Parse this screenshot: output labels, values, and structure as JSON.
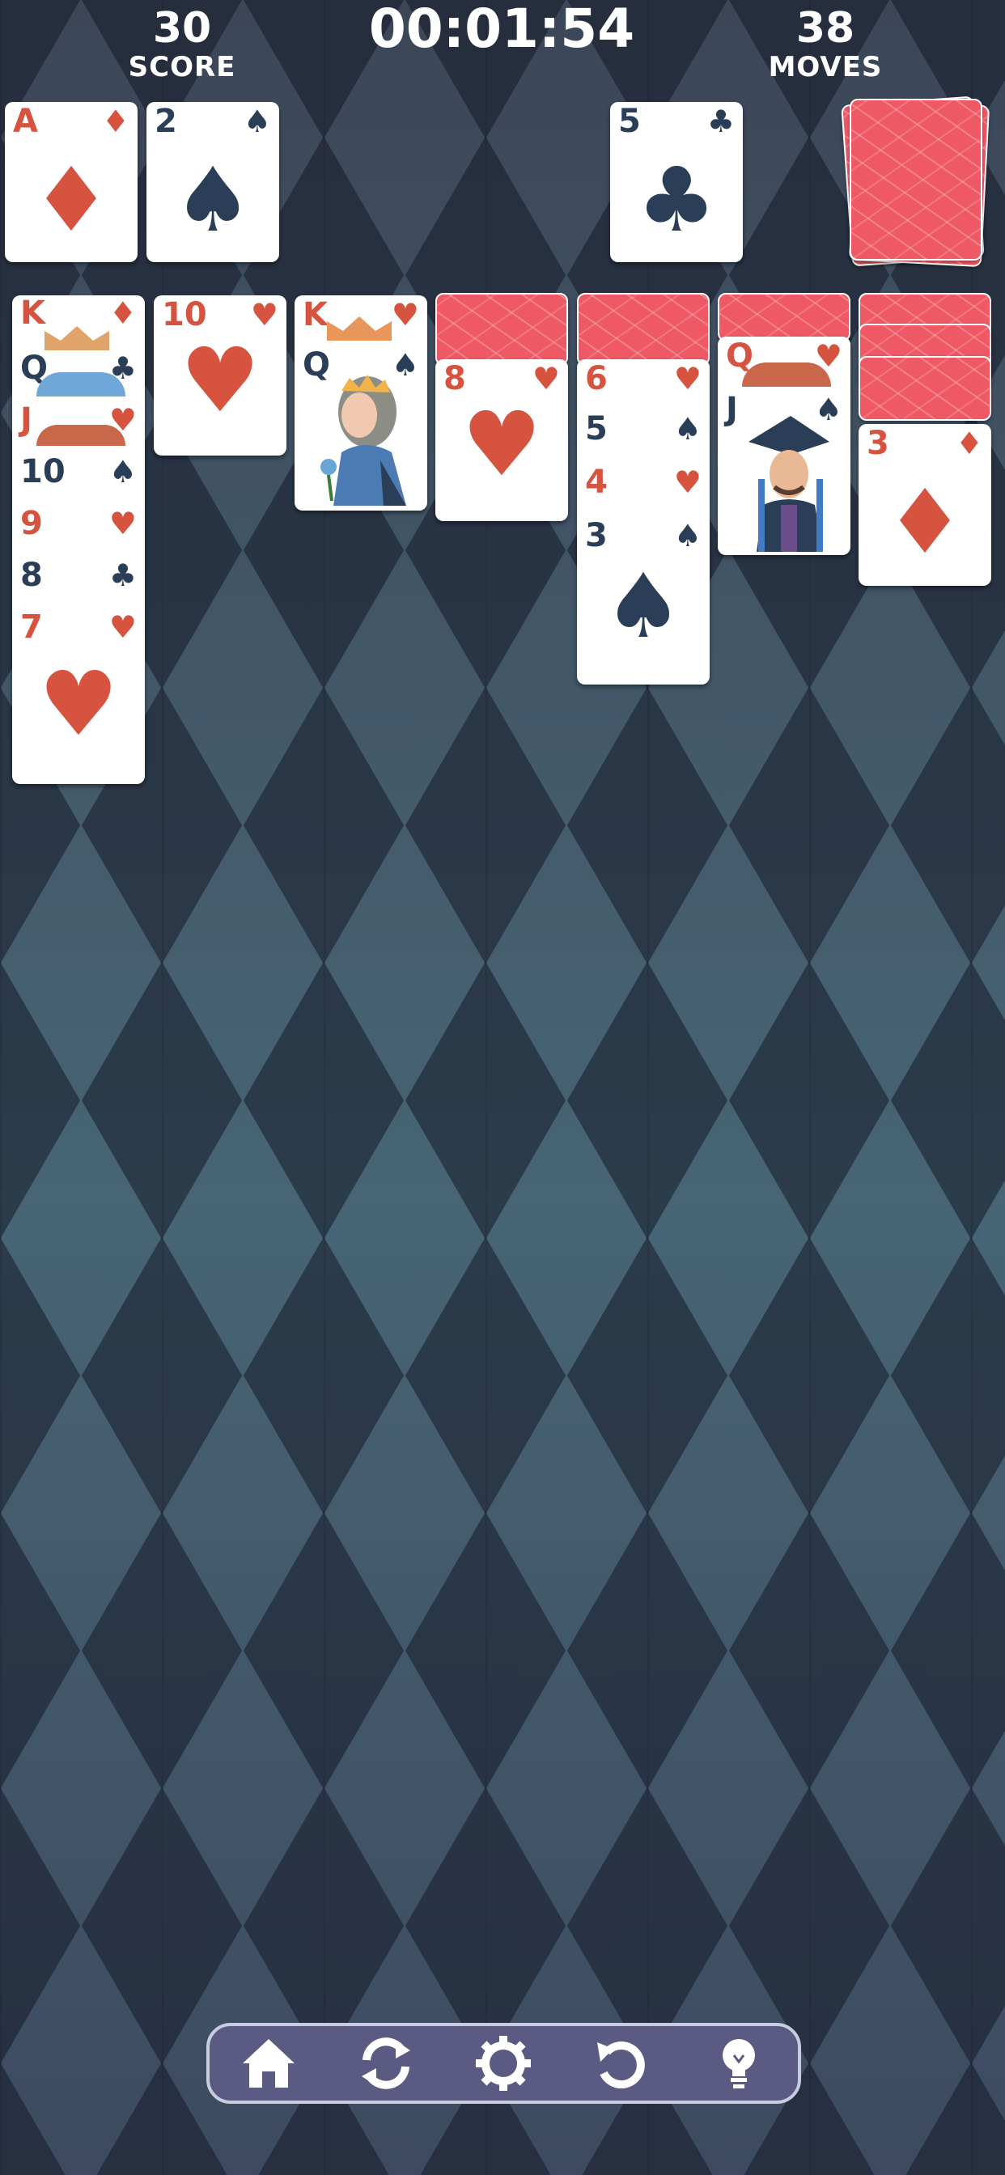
{
  "hud": {
    "score_value": "30",
    "score_label": "SCORE",
    "timer": "00:01:54",
    "moves_value": "38",
    "moves_label": "MOVES"
  },
  "foundations": [
    {
      "rank": "A",
      "suit": "♦",
      "color": "red"
    },
    {
      "rank": "2",
      "suit": "♠",
      "color": "black"
    }
  ],
  "waste": {
    "rank": "5",
    "suit": "♣",
    "color": "black"
  },
  "stock": {
    "state": "face-down"
  },
  "tableau": [
    {
      "face_down": 0,
      "face_up": [
        {
          "rank": "K",
          "suit": "♦"
        },
        {
          "rank": "Q",
          "suit": "♣"
        },
        {
          "rank": "J",
          "suit": "♥"
        },
        {
          "rank": "10",
          "suit": "♠"
        },
        {
          "rank": "9",
          "suit": "♥"
        },
        {
          "rank": "8",
          "suit": "♣"
        },
        {
          "rank": "7",
          "suit": "♥"
        }
      ]
    },
    {
      "face_down": 0,
      "face_up": [
        {
          "rank": "10",
          "suit": "♥"
        }
      ]
    },
    {
      "face_down": 0,
      "face_up": [
        {
          "rank": "K",
          "suit": "♥"
        },
        {
          "rank": "Q",
          "suit": "♠"
        }
      ]
    },
    {
      "face_down": 1,
      "face_up": [
        {
          "rank": "8",
          "suit": "♥"
        }
      ]
    },
    {
      "face_down": 1,
      "face_up": [
        {
          "rank": "6",
          "suit": "♥"
        },
        {
          "rank": "5",
          "suit": "♠"
        },
        {
          "rank": "4",
          "suit": "♥"
        },
        {
          "rank": "3",
          "suit": "♠"
        }
      ]
    },
    {
      "face_down": 1,
      "face_up": [
        {
          "rank": "Q",
          "suit": "♥"
        },
        {
          "rank": "J",
          "suit": "♠"
        }
      ]
    },
    {
      "face_down": 3,
      "face_up": [
        {
          "rank": "3",
          "suit": "♦"
        }
      ]
    }
  ],
  "toolbar": {
    "buttons": [
      "home-icon",
      "restart-icon",
      "settings-icon",
      "undo-icon",
      "hint-icon"
    ]
  },
  "colors": {
    "red_suit": "#d5533f",
    "black_suit": "#2b3e57",
    "card_back": "#ee5965",
    "toolbar": "#5a5a82"
  }
}
